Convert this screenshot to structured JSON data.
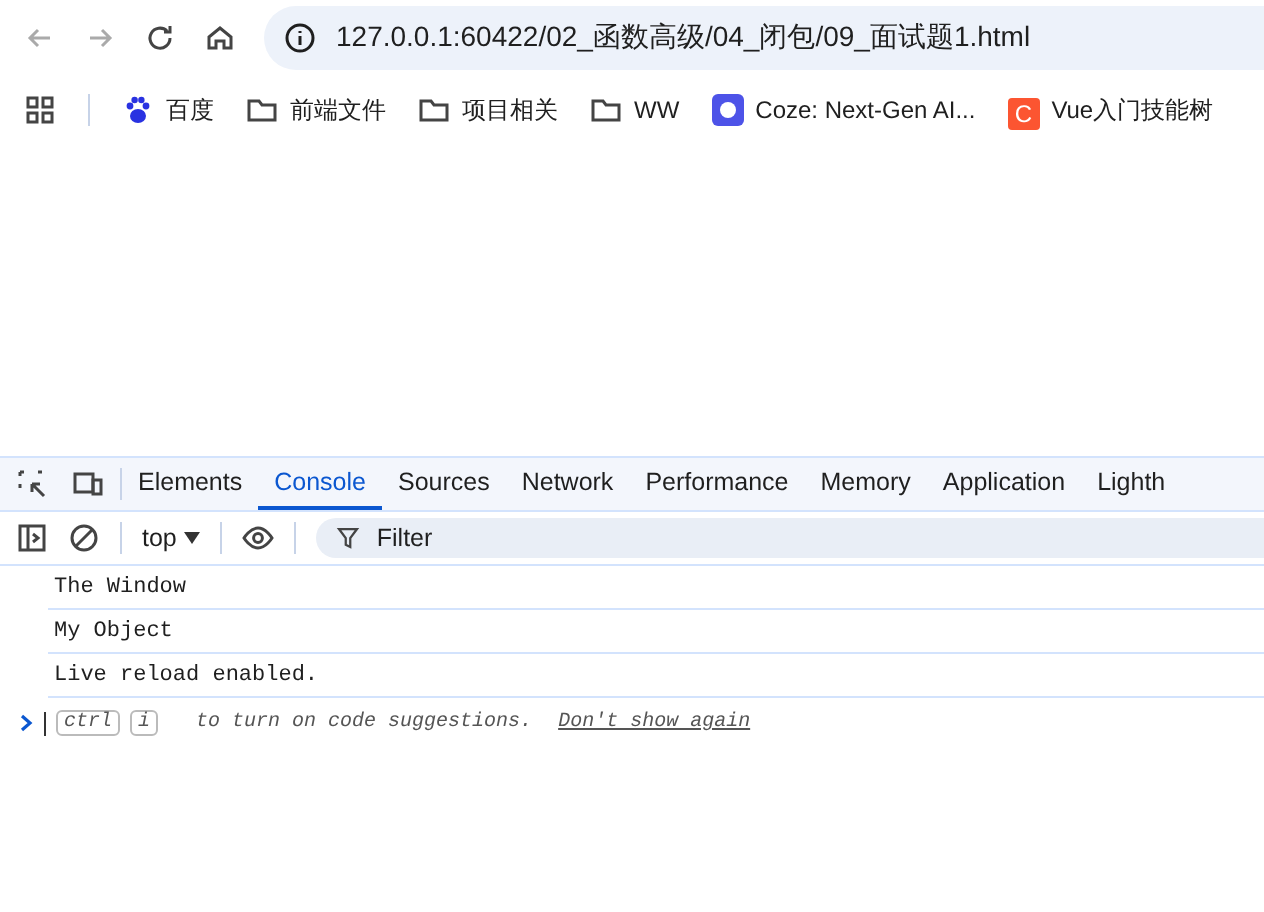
{
  "address_bar": {
    "url": "127.0.0.1:60422/02_函数高级/04_闭包/09_面试题1.html"
  },
  "bookmarks": [
    {
      "kind": "paw",
      "label": "百度"
    },
    {
      "kind": "folder",
      "label": "前端文件"
    },
    {
      "kind": "folder",
      "label": "项目相关"
    },
    {
      "kind": "folder",
      "label": "WW"
    },
    {
      "kind": "bot",
      "label": "Coze: Next-Gen AI..."
    },
    {
      "kind": "letter",
      "glyph": "C",
      "label": "Vue入门技能树"
    }
  ],
  "devtools": {
    "tabs": [
      {
        "label": "Elements",
        "selected": false
      },
      {
        "label": "Console",
        "selected": true
      },
      {
        "label": "Sources",
        "selected": false
      },
      {
        "label": "Network",
        "selected": false
      },
      {
        "label": "Performance",
        "selected": false
      },
      {
        "label": "Memory",
        "selected": false
      },
      {
        "label": "Application",
        "selected": false
      },
      {
        "label": "Lighth",
        "selected": false
      }
    ],
    "context": "top",
    "filter": {
      "placeholder": "Filter"
    },
    "messages": [
      "The Window",
      "My Object",
      "Live reload enabled."
    ],
    "prompt": {
      "keys": [
        "ctrl",
        "i"
      ],
      "hint": "to turn on code suggestions.",
      "link": "Don't show again"
    }
  }
}
